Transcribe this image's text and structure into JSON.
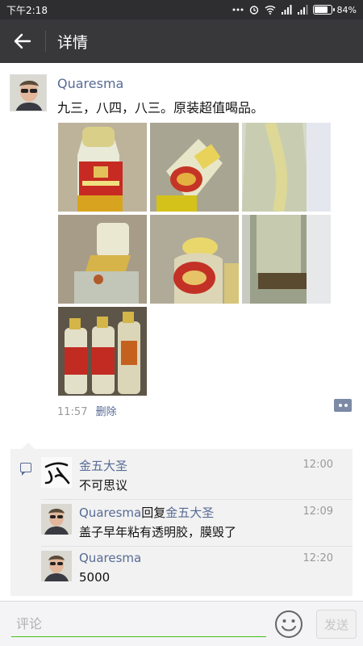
{
  "status_bar": {
    "time": "下午2:18",
    "battery": "84%",
    "battery_level": 0.84
  },
  "header": {
    "title": "详情"
  },
  "post": {
    "author": "Quaresma",
    "text": "九三，八四，八三。原装超值喝品。",
    "photos": [
      "photo-1",
      "photo-2",
      "photo-3",
      "photo-4",
      "photo-5",
      "photo-6",
      "photo-7"
    ],
    "time": "11:57",
    "delete_label": "删除"
  },
  "comments": [
    {
      "author": "金五大圣",
      "text": "不可思议",
      "time": "12:00"
    },
    {
      "author": "Quaresma",
      "reply_word": "回复",
      "reply_to": "金五大圣",
      "text": "盖子早年粘有透明胶，膜毁了",
      "time": "12:09"
    },
    {
      "author": "Quaresma",
      "text": "5000",
      "time": "12:20"
    }
  ],
  "input": {
    "placeholder": "评论",
    "send_label": "发送"
  },
  "colors": {
    "link": "#576b95",
    "accent_green": "#45c01a",
    "header_bg": "#38383b"
  }
}
